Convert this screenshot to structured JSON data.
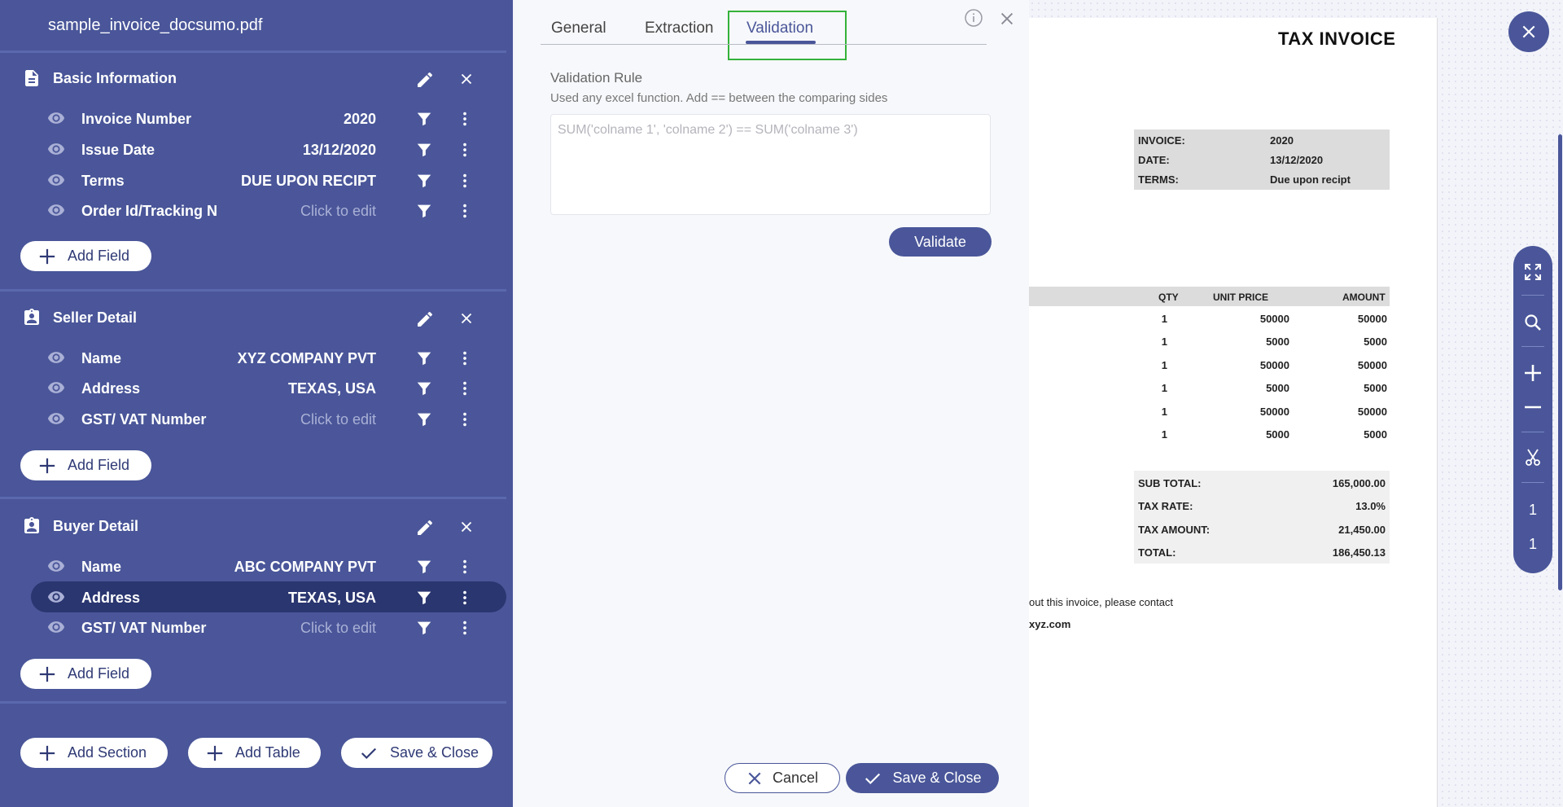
{
  "sidebar": {
    "file_title": "sample_invoice_docsumo.pdf",
    "sections": [
      {
        "title": "Basic Information",
        "icon": "document-icon",
        "fields": [
          {
            "label": "Invoice Number",
            "value": "2020",
            "placeholder": false
          },
          {
            "label": "Issue Date",
            "value": "13/12/2020",
            "placeholder": false
          },
          {
            "label": "Terms",
            "value": "DUE UPON RECIPT",
            "placeholder": false
          },
          {
            "label": "Order Id/Tracking No",
            "value": "Click to edit",
            "placeholder": true
          }
        ],
        "add_field_label": "Add Field"
      },
      {
        "title": "Seller Detail",
        "icon": "contact-card-icon",
        "fields": [
          {
            "label": "Name",
            "value": "XYZ COMPANY PVT",
            "placeholder": false
          },
          {
            "label": "Address",
            "value": "TEXAS, USA",
            "placeholder": false
          },
          {
            "label": "GST/ VAT Number",
            "value": "Click to edit",
            "placeholder": true
          }
        ],
        "add_field_label": "Add Field"
      },
      {
        "title": "Buyer Detail",
        "icon": "contact-card-icon",
        "fields": [
          {
            "label": "Name",
            "value": "ABC COMPANY PVT",
            "placeholder": false
          },
          {
            "label": "Address",
            "value": "TEXAS, USA",
            "placeholder": false,
            "selected": true
          },
          {
            "label": "GST/ VAT Number",
            "value": "Click to edit",
            "placeholder": true
          }
        ],
        "add_field_label": "Add Field"
      }
    ],
    "footer": {
      "add_section_label": "Add Section",
      "add_table_label": "Add Table",
      "save_close_label": "Save & Close"
    }
  },
  "panel": {
    "tabs": [
      "General",
      "Extraction",
      "Validation"
    ],
    "active_tab": "Validation",
    "validation_title": "Validation Rule",
    "validation_subtitle": "Used any excel function. Add == between the comparing sides",
    "rule_placeholder": "SUM('colname 1', 'colname 2') == SUM('colname 3')",
    "validate_label": "Validate",
    "cancel_label": "Cancel",
    "save_close_label": "Save & Close"
  },
  "document": {
    "title": "TAX INVOICE",
    "meta": [
      {
        "key": "INVOICE:",
        "value": "2020"
      },
      {
        "key": "DATE:",
        "value": "13/12/2020"
      },
      {
        "key": "TERMS:",
        "value": "Due upon recipt"
      }
    ],
    "table_headers": [
      "QTY",
      "UNIT PRICE",
      "AMOUNT"
    ],
    "rows": [
      [
        "1",
        "50000",
        "50000"
      ],
      [
        "1",
        "5000",
        "5000"
      ],
      [
        "1",
        "50000",
        "50000"
      ],
      [
        "1",
        "5000",
        "5000"
      ],
      [
        "1",
        "50000",
        "50000"
      ],
      [
        "1",
        "5000",
        "5000"
      ]
    ],
    "totals": [
      {
        "key": "SUB TOTAL:",
        "value": "165,000.00"
      },
      {
        "key": "TAX RATE:",
        "value": "13.0%"
      },
      {
        "key": "TAX AMOUNT:",
        "value": "21,450.00"
      },
      {
        "key": "TOTAL:",
        "value": "186,450.13"
      }
    ],
    "footer_line1": "out this invoice, please contact",
    "footer_line2": "xyz.com"
  },
  "viewer_toolbar": {
    "page_current": "1",
    "page_total": "1"
  },
  "colors": {
    "sidebar": "#4a5699",
    "selected_row": "#2a3670",
    "focus_outline": "#34b23a"
  }
}
